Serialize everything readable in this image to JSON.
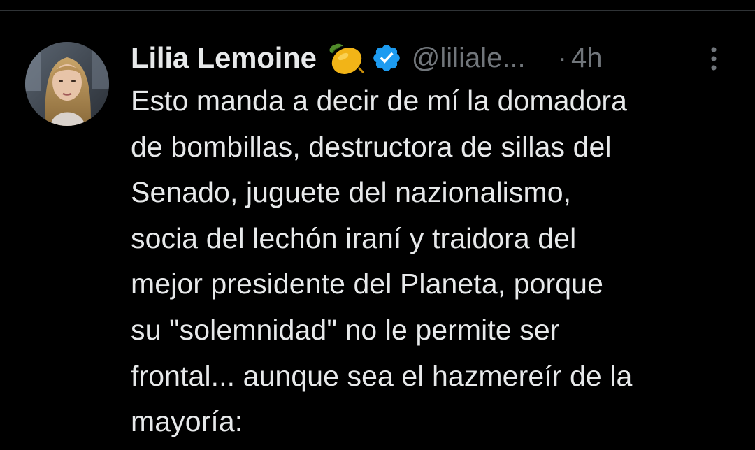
{
  "tweet": {
    "author": {
      "display_name": "Lilia Lemoine",
      "emoji": "lemon-emoji",
      "verified": true,
      "verified_badge_color": "#1d9bf0",
      "handle": "@liliale..."
    },
    "separator": "·",
    "time": "4h",
    "more_icon": "more-vertical-icon",
    "text": "Esto manda a decir de mí la domadora\nde bombillas, destructora de sillas del\nSenado, juguete del nazionalismo,\nsocia del lechón iraní y traidora del\nmejor presidente del Planeta, porque\nsu \"solemnidad\" no le permite ser\nfrontal... aunque sea el hazmereír de la\nmayoría:"
  },
  "theme": {
    "background": "#000000",
    "primary_text": "#e7e9ea",
    "secondary_text": "#71767b",
    "divider": "#2f3336"
  }
}
